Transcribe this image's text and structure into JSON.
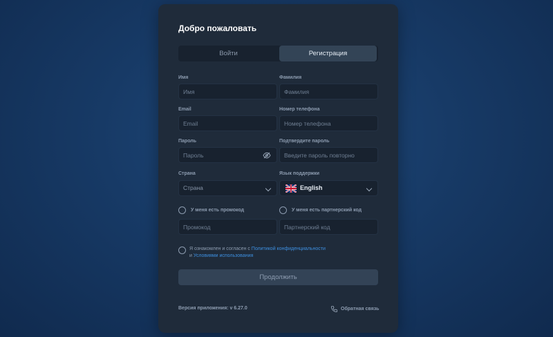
{
  "title": "Добро пожаловать",
  "tabs": {
    "login": "Войти",
    "register": "Регистрация"
  },
  "fields": {
    "first_name": {
      "label": "Имя",
      "placeholder": "Имя"
    },
    "last_name": {
      "label": "Фамилия",
      "placeholder": "Фамилия"
    },
    "email": {
      "label": "Email",
      "placeholder": "Email"
    },
    "phone": {
      "label": "Номер телефона",
      "placeholder": "Номер телефона"
    },
    "password": {
      "label": "Пароль",
      "placeholder": "Пароль"
    },
    "password_confirm": {
      "label": "Подтвердите пароль",
      "placeholder": "Введите пароль повторно"
    },
    "country": {
      "label": "Страна",
      "value": "Страна"
    },
    "support_lang": {
      "label": "Язык поддержки",
      "value": "English"
    },
    "promo": {
      "check_label": "У меня есть промокод",
      "placeholder": "Промокод"
    },
    "partner": {
      "check_label": "У меня есть партнерский код",
      "placeholder": "Партнерский код"
    }
  },
  "agree": {
    "prefix": "Я ознакомлен и согласен с ",
    "privacy_link": "Политикой конфиденциальности",
    "and": "и ",
    "terms_link": "Условиями использования"
  },
  "continue_label": "Продолжить",
  "version_text": "Версия приложения: v 6.27.0",
  "feedback_label": "Обратная связь",
  "icons": {
    "eye": "eye-slash-icon",
    "chevron": "chevron-down-icon",
    "flag": "uk-flag-icon",
    "phone": "phone-icon"
  },
  "colors": {
    "accent_link": "#3d8fe0",
    "card_bg": "#1f2b3a",
    "active_tab": "#334456"
  }
}
